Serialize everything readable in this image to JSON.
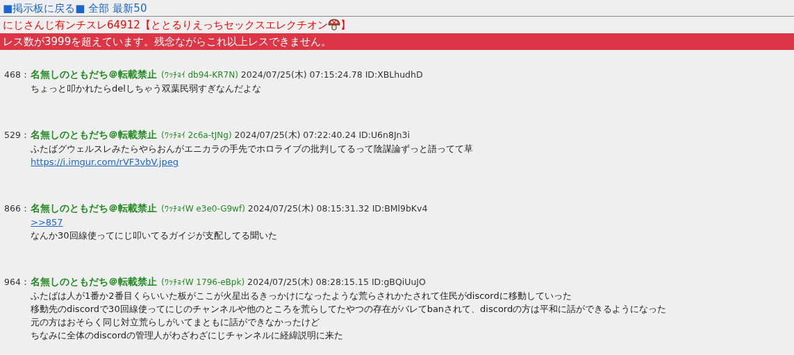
{
  "nav": [
    {
      "label": "■掲示板に戻る■"
    },
    {
      "label": "全部"
    },
    {
      "label": "最新50"
    }
  ],
  "thread_title": {
    "before": "にじさんじ有ンチスレ64912【ととるりえっちセックスエレクチオン",
    "after": "】"
  },
  "notice": "レス数が3999を超えています。残念ながらこれ以上レスできません。",
  "posts": [
    {
      "number": "468",
      "separator": "：",
      "name": "名無しのともだち＠転載禁止",
      "trip": "(ﾜｯﾁｮｲ db94-KR7N)",
      "date": "2024/07/25(木) 07:15:24.78",
      "id": "ID:XBLhudhD",
      "lines": [
        {
          "kind": "text",
          "text": "ちょっと叩かれたらdelしちゃう双葉民弱すぎなんだよな"
        }
      ]
    },
    {
      "number": "529",
      "separator": "：",
      "name": "名無しのともだち＠転載禁止",
      "trip": "(ﾜｯﾁｮｲ 2c6a-tJNg)",
      "date": "2024/07/25(木) 07:22:40.24",
      "id": "ID:U6n8Jn3i",
      "lines": [
        {
          "kind": "text",
          "text": "ふたばグウェルスレみたらやらおんがエニカラの手先でホロライブの批判してるって陰謀論ずっと語ってて草"
        },
        {
          "kind": "link",
          "text": "https://i.imgur.com/rVF3vbV.jpeg"
        }
      ]
    },
    {
      "number": "866",
      "separator": "：",
      "name": "名無しのともだち＠転載禁止",
      "trip": "(ﾜｯﾁｮｲW e3e0-G9wf)",
      "date": "2024/07/25(木) 08:15:31.32",
      "id": "ID:BMl9bKv4",
      "lines": [
        {
          "kind": "link",
          "text": ">>857"
        },
        {
          "kind": "text",
          "text": "なんか30回線使ってにじ叩いてるガイジが支配してる聞いた"
        }
      ]
    },
    {
      "number": "964",
      "separator": "：",
      "name": "名無しのともだち＠転載禁止",
      "trip": "(ﾜｯﾁｮｲW 1796-eBpk)",
      "date": "2024/07/25(木) 08:28:15.15",
      "id": "ID:gBQiUuJO",
      "lines": [
        {
          "kind": "text",
          "text": "ふたばは人が1番か2番目くらいいた板がここが火星出るきっかけになったような荒らされかたされて住民がdiscordに移動していった"
        },
        {
          "kind": "text",
          "text": "移動先のdiscordで30回線使ってにじのチャンネルや他のところを荒らしてたやつの存在がバレてbanされて、discordの方は平和に話ができるようになった"
        },
        {
          "kind": "text",
          "text": "元の方はおそらく同じ対立荒らしがいてまともに話ができなかったけど"
        },
        {
          "kind": "text",
          "text": "ちなみに全体のdiscordの管理人がわざわざにじチャンネルに経緯説明に来た"
        }
      ]
    }
  ]
}
